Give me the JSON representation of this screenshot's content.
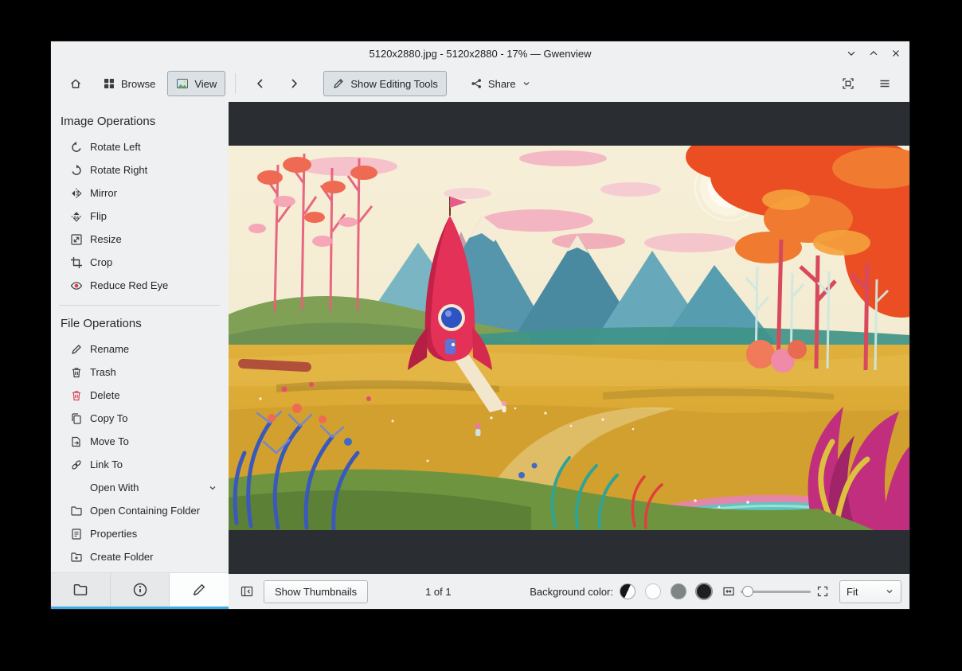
{
  "colors": {
    "accent": "#3daee9",
    "viewer_background": "#2a2e32"
  },
  "window": {
    "title": "5120x2880.jpg - 5120x2880 - 17% — Gwenview"
  },
  "toolbar": {
    "browse_label": "Browse",
    "view_label": "View",
    "editing_tools_label": "Show Editing Tools",
    "share_label": "Share"
  },
  "sidebar": {
    "image_operations": {
      "title": "Image Operations",
      "items": [
        {
          "label": "Rotate Left",
          "icon": "rotate-left-icon"
        },
        {
          "label": "Rotate Right",
          "icon": "rotate-right-icon"
        },
        {
          "label": "Mirror",
          "icon": "mirror-icon"
        },
        {
          "label": "Flip",
          "icon": "flip-icon"
        },
        {
          "label": "Resize",
          "icon": "resize-icon"
        },
        {
          "label": "Crop",
          "icon": "crop-icon"
        },
        {
          "label": "Reduce Red Eye",
          "icon": "red-eye-icon"
        }
      ]
    },
    "file_operations": {
      "title": "File Operations",
      "items": [
        {
          "label": "Rename",
          "icon": "rename-icon"
        },
        {
          "label": "Trash",
          "icon": "trash-icon"
        },
        {
          "label": "Delete",
          "icon": "delete-icon"
        },
        {
          "label": "Copy To",
          "icon": "copy-icon"
        },
        {
          "label": "Move To",
          "icon": "move-icon"
        },
        {
          "label": "Link To",
          "icon": "link-icon"
        },
        {
          "label": "Open With",
          "icon": null
        },
        {
          "label": "Open Containing Folder",
          "icon": "folder-icon"
        },
        {
          "label": "Properties",
          "icon": "properties-icon"
        },
        {
          "label": "Create Folder",
          "icon": "create-folder-icon"
        }
      ]
    }
  },
  "viewer": {
    "image_description": "Colorful stylized landscape illustration: red rocket on yellow field, teal mountains, cream sky, orange trees, blue ferns"
  },
  "statusbar": {
    "show_thumbnails_label": "Show Thumbnails",
    "page_indicator": "1 of 1",
    "background_color_label": "Background color:",
    "swatches": [
      {
        "name": "auto",
        "value": "black-white"
      },
      {
        "name": "light",
        "value": "#ffffff"
      },
      {
        "name": "neutral",
        "value": "#7f8487"
      },
      {
        "name": "dark",
        "value": "#1d2023"
      }
    ],
    "zoom_mode": "Fit"
  }
}
